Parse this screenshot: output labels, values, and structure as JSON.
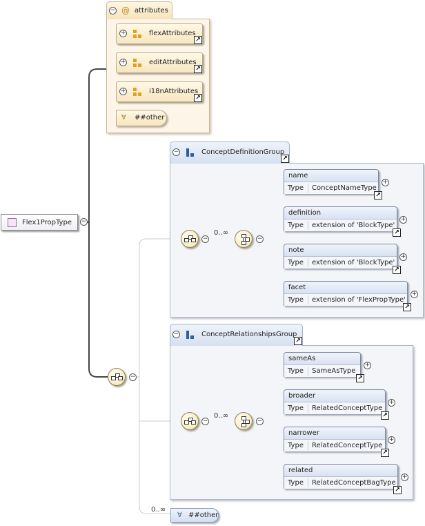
{
  "root": {
    "label": "Flex1PropType"
  },
  "attributes_group": {
    "title": "attributes",
    "at_symbol": "@",
    "items": [
      {
        "label": "flexAttributes"
      },
      {
        "label": "editAttributes"
      },
      {
        "label": "i18nAttributes"
      }
    ],
    "any_attribute": "##other"
  },
  "concept_definition_group": {
    "title": "ConceptDefinitionGroup",
    "occurrence": "0..∞",
    "elements": [
      {
        "name": "name",
        "type_label": "Type",
        "type": "ConceptNameType"
      },
      {
        "name": "definition",
        "type_label": "Type",
        "type": "extension of 'BlockType'"
      },
      {
        "name": "note",
        "type_label": "Type",
        "type": "extension of 'BlockType'"
      },
      {
        "name": "facet",
        "type_label": "Type",
        "type": "extension of 'FlexPropType'"
      }
    ]
  },
  "concept_relationships_group": {
    "title": "ConceptRelationshipsGroup",
    "occurrence": "0..∞",
    "elements": [
      {
        "name": "sameAs",
        "type_label": "Type",
        "type": "SameAsType"
      },
      {
        "name": "broader",
        "type_label": "Type",
        "type": "RelatedConceptType"
      },
      {
        "name": "narrower",
        "type_label": "Type",
        "type": "RelatedConceptType"
      },
      {
        "name": "related",
        "type_label": "Type",
        "type": "RelatedConceptBagType"
      }
    ]
  },
  "any_element": {
    "occurrence": "0..∞",
    "label": "##other"
  },
  "glyphs": {
    "expand": "+",
    "collapse": "−",
    "link": "↗",
    "any": "∀"
  }
}
